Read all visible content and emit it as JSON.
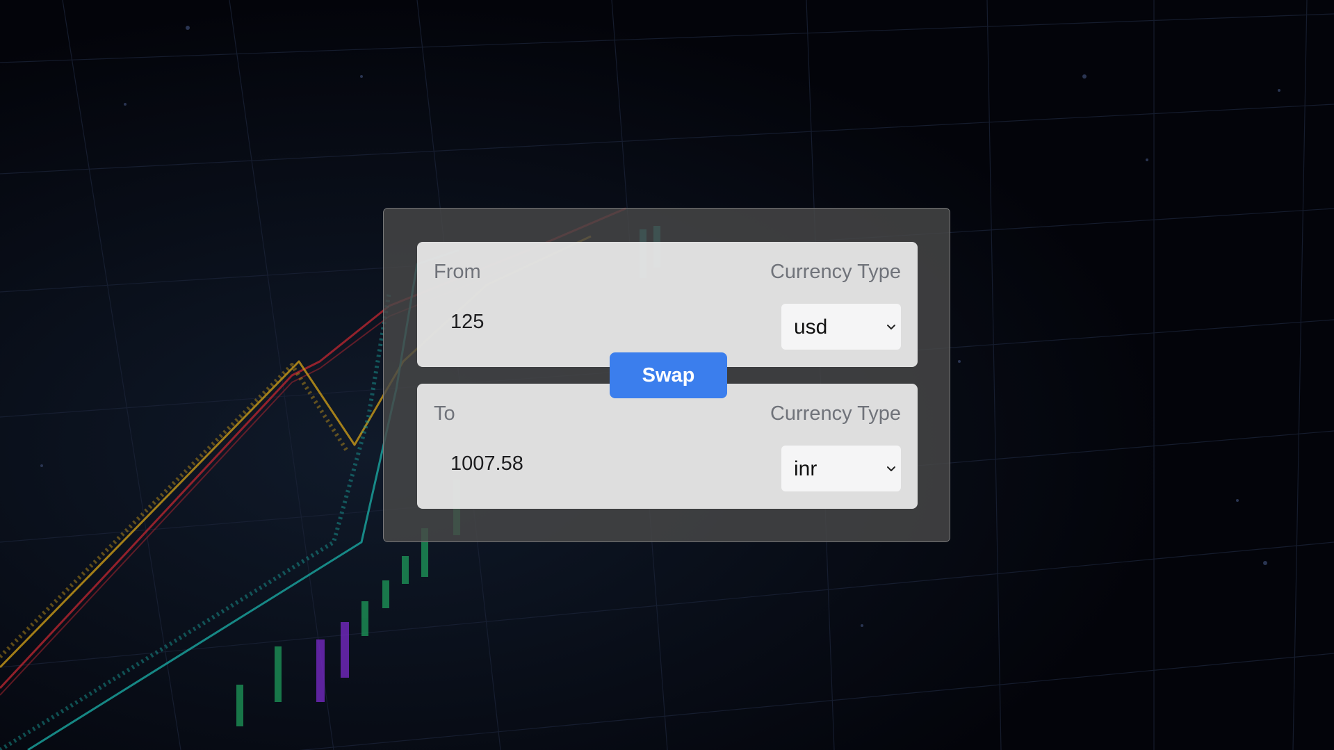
{
  "converter": {
    "from": {
      "label": "From",
      "currency_label": "Currency Type",
      "amount": "125",
      "currency": "usd"
    },
    "to": {
      "label": "To",
      "currency_label": "Currency Type",
      "amount": "1007.58",
      "currency": "inr"
    },
    "swap_label": "Swap"
  },
  "icons": {
    "select_arrow": "chevron-down-icon"
  },
  "colors": {
    "swap_button": "#3b7eed",
    "panel_background": "#f0f0f0",
    "card_background": "#484848",
    "label_text": "#70737a"
  }
}
